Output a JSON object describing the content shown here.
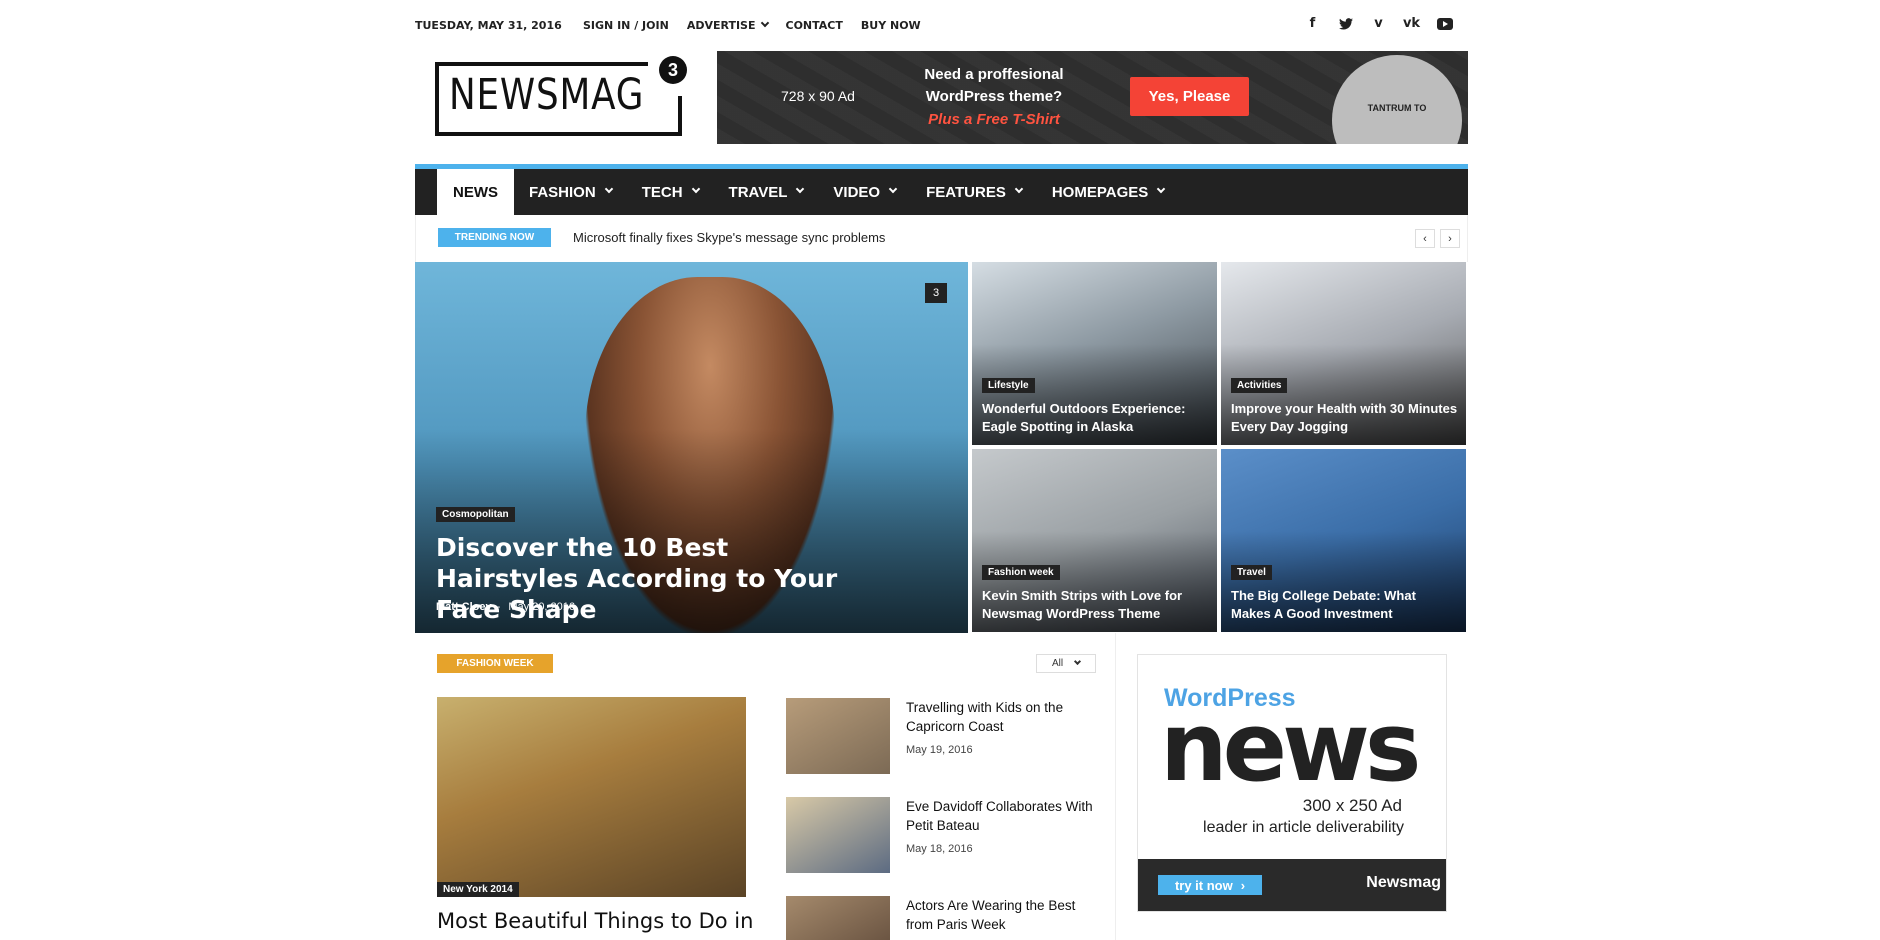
{
  "topbar": {
    "date": "TUESDAY, MAY 31, 2016",
    "links": {
      "signin": "SIGN IN / JOIN",
      "advertise": "ADVERTISE",
      "contact": "CONTACT",
      "buy": "BUY NOW"
    },
    "social": [
      "facebook-icon",
      "twitter-icon",
      "vimeo-icon",
      "vk-icon",
      "youtube-icon"
    ]
  },
  "logo": {
    "text": "NEWSMAG",
    "version": "3"
  },
  "banner": {
    "size": "728 x 90 Ad",
    "line1": "Need a proffesional",
    "line2": "WordPress theme?",
    "line3": "Plus a Free T-Shirt",
    "button": "Yes, Please",
    "shirt_text": "TANTRUM TO"
  },
  "nav": {
    "items": [
      {
        "label": "NEWS"
      },
      {
        "label": "FASHION"
      },
      {
        "label": "TECH"
      },
      {
        "label": "TRAVEL"
      },
      {
        "label": "VIDEO"
      },
      {
        "label": "FEATURES"
      },
      {
        "label": "HOMEPAGES"
      }
    ]
  },
  "trending": {
    "badge": "TRENDING NOW",
    "headline": "Microsoft finally fixes Skype's message sync problems"
  },
  "featured": {
    "big": {
      "category": "Cosmopolitan",
      "title": "Discover the 10 Best Hairstyles According to Your Face Shape",
      "author": "Matt Cloey",
      "separator": "-",
      "date": "May 20, 2016",
      "comments": "3"
    },
    "tiles": [
      {
        "category": "Lifestyle",
        "title": "Wonderful Outdoors Experience: Eagle Spotting in Alaska"
      },
      {
        "category": "Activities",
        "title": "Improve your Health with 30 Minutes Every Day Jogging"
      },
      {
        "category": "Fashion week",
        "title": "Kevin Smith Strips with Love for Newsmag WordPress Theme"
      },
      {
        "category": "Travel",
        "title": "The Big College Debate: What Makes A Good Investment"
      }
    ]
  },
  "fashion_week": {
    "badge": "FASHION WEEK",
    "filter": "All",
    "main": {
      "category": "New York 2014",
      "title": "Most Beautiful Things to Do in"
    },
    "list": [
      {
        "title": "Travelling with Kids on the Capricorn Coast",
        "date": "May 19, 2016"
      },
      {
        "title": "Eve Davidoff Collaborates With Petit Bateau",
        "date": "May 18, 2016"
      },
      {
        "title": "Actors Are Wearing the Best from Paris Week",
        "date": ""
      }
    ]
  },
  "sidebar_ad": {
    "wordpress": "WordPress",
    "news": "news",
    "size": "300 x 250 Ad",
    "tagline": "leader in article deliverability",
    "cta": "try it now",
    "brand": "Newsmag"
  },
  "colors": {
    "accent": "#4db2ec",
    "dark": "#222222",
    "fashion_badge": "#e6a32b",
    "banner_button": "#f44336"
  }
}
